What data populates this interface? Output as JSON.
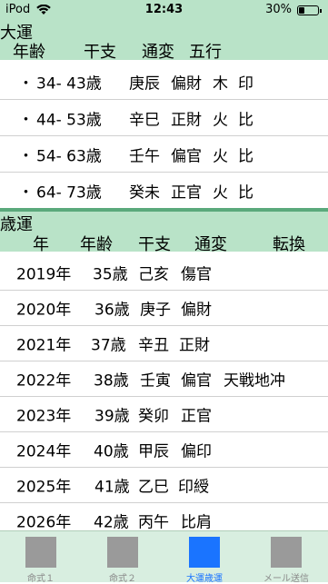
{
  "status": {
    "carrier": "iPod",
    "time": "12:43",
    "battery": "30%",
    "battery_level": 0.3
  },
  "daiun": {
    "title": "大運",
    "headers": {
      "age": "年齢",
      "kanshi": "干支",
      "tsuhen": "通変",
      "gogyo": "五行"
    },
    "rows": [
      {
        "bullet": "・",
        "age": "34- 43歳",
        "kanshi": "庚辰",
        "tsuhen": "偏財",
        "element": "木",
        "relation": "印"
      },
      {
        "bullet": "・",
        "age": "44- 53歳",
        "kanshi": "辛巳",
        "tsuhen": "正財",
        "element": "火",
        "relation": "比"
      },
      {
        "bullet": "・",
        "age": "54- 63歳",
        "kanshi": "壬午",
        "tsuhen": "偏官",
        "element": "火",
        "relation": "比"
      },
      {
        "bullet": "・",
        "age": "64- 73歳",
        "kanshi": "癸未",
        "tsuhen": "正官",
        "element": "火",
        "relation": "比"
      }
    ]
  },
  "saiun": {
    "title": "歳運",
    "headers": {
      "year": "年",
      "age": "年齢",
      "kanshi": "干支",
      "tsuhen": "通変",
      "tenkan": "転換"
    },
    "rows": [
      {
        "year": "2019年",
        "age": "35歳",
        "kanshi": "己亥",
        "tsuhen": "傷官",
        "tenkan": ""
      },
      {
        "year": "2020年",
        "age": "36歳",
        "kanshi": "庚子",
        "tsuhen": "偏財",
        "tenkan": ""
      },
      {
        "year": "2021年",
        "age": "37歳",
        "kanshi": "辛丑",
        "tsuhen": "正財",
        "tenkan": ""
      },
      {
        "year": "2022年",
        "age": "38歳",
        "kanshi": "壬寅",
        "tsuhen": "偏官",
        "tenkan": "天戦地冲"
      },
      {
        "year": "2023年",
        "age": "39歳",
        "kanshi": "癸卯",
        "tsuhen": "正官",
        "tenkan": ""
      },
      {
        "year": "2024年",
        "age": "40歳",
        "kanshi": "甲辰",
        "tsuhen": "偏印",
        "tenkan": ""
      },
      {
        "year": "2025年",
        "age": "41歳",
        "kanshi": "乙巳",
        "tsuhen": "印綬",
        "tenkan": ""
      },
      {
        "year": "2026年",
        "age": "42歳",
        "kanshi": "丙午",
        "tsuhen": "比肩",
        "tenkan": ""
      }
    ]
  },
  "tabs": [
    {
      "label": "命式１",
      "icon": "meishiki1-icon",
      "active": false
    },
    {
      "label": "命式２",
      "icon": "meishiki2-icon",
      "active": false
    },
    {
      "label": "大運歳運",
      "icon": "daiun-saiun-icon",
      "active": true
    },
    {
      "label": "メール送信",
      "icon": "mail-send-icon",
      "active": false
    }
  ],
  "colors": {
    "header_bg": "#b9e3c8",
    "divider": "#5aa97c",
    "tab_active": "#1a74ff",
    "tab_inactive": "#9a9a9a"
  }
}
